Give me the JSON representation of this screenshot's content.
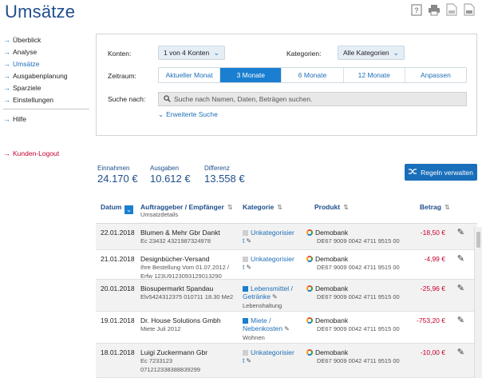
{
  "page": {
    "title": "Umsätze"
  },
  "top_icons": [
    "help-icon",
    "print-icon",
    "pdf-export-icon",
    "csv-export-icon"
  ],
  "sidebar": {
    "items": [
      {
        "label": "Überblick"
      },
      {
        "label": "Analyse"
      },
      {
        "label": "Umsätze",
        "active": true
      },
      {
        "label": "Ausgabenplanung"
      },
      {
        "label": "Sparziele"
      },
      {
        "label": "Einstellungen"
      }
    ],
    "help": "Hilfe",
    "logout": "Kunden-Logout"
  },
  "filters": {
    "konten_label": "Konten:",
    "konten_value": "1 von 4 Konten",
    "kategorien_label": "Kategorien:",
    "kategorien_value": "Alle Kategorien",
    "zeitraum_label": "Zeitraum:",
    "zeitraum_options": [
      "Aktueller Monat",
      "3 Monate",
      "6 Monate",
      "12 Monate",
      "Anpassen"
    ],
    "zeitraum_selected": "3 Monate",
    "suche_label": "Suche nach:",
    "suche_placeholder": "Suche nach Namen, Daten, Beträgen suchen.",
    "advanced_search": "Erweiterte Suche"
  },
  "summary": {
    "einnahmen_label": "Einnahmen",
    "einnahmen_value": "24.170 €",
    "ausgaben_label": "Ausgaben",
    "ausgaben_value": "10.612 €",
    "differenz_label": "Differenz",
    "differenz_value": "13.558 €"
  },
  "rules_button": "Regeln verwalten",
  "table": {
    "headers": {
      "datum": "Datum",
      "auftraggeber": "Auftraggeber / Empfänger",
      "umsatzdetails": "Umsatzdetails",
      "kategorie": "Kategorie",
      "produkt": "Produkt",
      "betrag": "Betrag"
    },
    "rows": [
      {
        "date": "22.01.2018",
        "payee": "Blumen & Mehr Gbr Dankt",
        "details": [
          "Ec 23432 4321987324978"
        ],
        "category_lines": [
          "Unkategorisier",
          "t"
        ],
        "category_sub": "",
        "category_color": "#cfcfcf",
        "product": "Demobank",
        "iban": "DE67 9009 0042 4711 9515 00",
        "amount": "-18,50 €"
      },
      {
        "date": "21.01.2018",
        "payee": "Designbücher-Versand",
        "details": [
          "Ihre Bestellung Vom 01.07.2012 /",
          "Erfw 123U9123093129013290"
        ],
        "category_lines": [
          "Unkategorisier",
          "t"
        ],
        "category_sub": "",
        "category_color": "#cfcfcf",
        "product": "Demobank",
        "iban": "DE67 9009 0042 4711 9515 00",
        "amount": "-4,99 €"
      },
      {
        "date": "20.01.2018",
        "payee": "Biosupermarkt Spandau",
        "details": [
          "Elv5424312375 010711 18.30 Me2"
        ],
        "category_lines": [
          "Lebensmittel /",
          "Getränke"
        ],
        "category_sub": "Lebenshaltung",
        "category_color": "#1a7fd0",
        "product": "Demobank",
        "iban": "DE67 9009 0042 4711 9515 00",
        "amount": "-25,96 €"
      },
      {
        "date": "19.01.2018",
        "payee": "Dr. House Solutions Gmbh",
        "details": [
          "Miete Juli 2012"
        ],
        "category_lines": [
          "Miete /",
          "Nebenkosten"
        ],
        "category_sub": "Wohnen",
        "category_color": "#1a7fd0",
        "product": "Demobank",
        "iban": "DE67 9009 0042 4711 9515 00",
        "amount": "-753,20 €"
      },
      {
        "date": "18.01.2018",
        "payee": "Luigi Zuckermann Gbr",
        "details": [
          "Ec 7233123",
          "071212338388839299"
        ],
        "category_lines": [
          "Unkategorisier",
          "t"
        ],
        "category_sub": "",
        "category_color": "#cfcfcf",
        "product": "Demobank",
        "iban": "DE67 9009 0042 4711 9515 00",
        "amount": "-10,00 €"
      }
    ]
  }
}
